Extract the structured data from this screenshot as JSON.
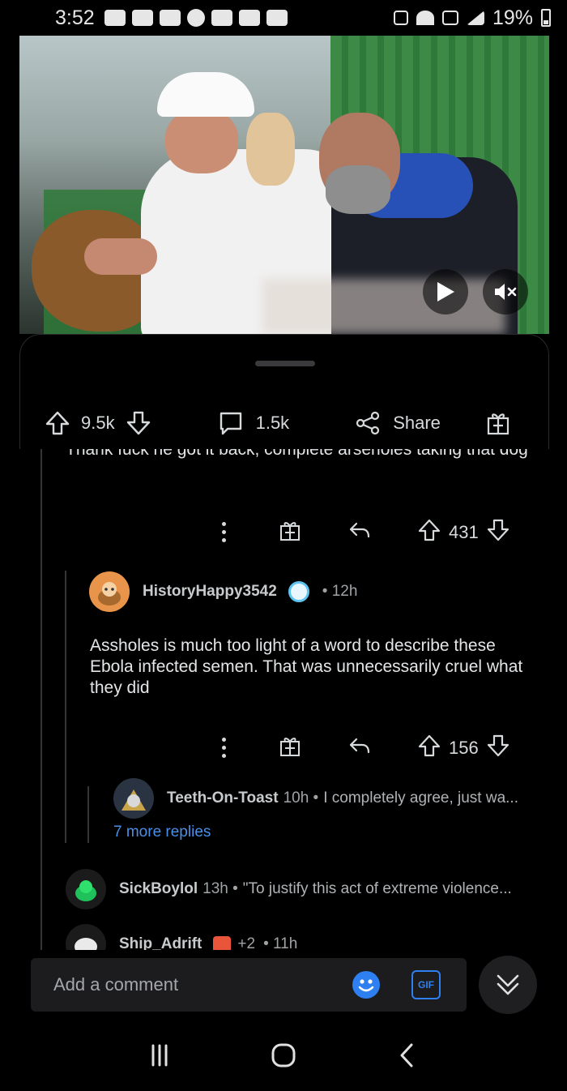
{
  "status_bar": {
    "time": "3:52",
    "battery": "19%"
  },
  "video": {
    "play_label": "play",
    "mute_label": "muted"
  },
  "post_actions": {
    "upvotes": "9.5k",
    "comments": "1.5k",
    "share": "Share"
  },
  "comments": [
    {
      "text": "Thank fuck he got it back, complete arseholes taking that dog",
      "votes": "431"
    },
    {
      "username": "HistoryHappy3542",
      "time": "• 12h",
      "text": "Assholes is much too light of a word to describe these Ebola infected semen. That was unnecessarily cruel what they did",
      "votes": "156"
    },
    {
      "username": "Teeth-On-Toast",
      "time": "10h •",
      "snippet": "I completely agree, just wa...",
      "more_replies": "7 more replies"
    },
    {
      "username": "SickBoylol",
      "time": "13h •",
      "snippet": "\"To justify this act of extreme violence..."
    },
    {
      "username": "Ship_Adrift",
      "awards": "+2",
      "time": "• 11h"
    }
  ],
  "comment_input": {
    "placeholder": "Add a comment",
    "gif_label": "GIF"
  },
  "colors": {
    "accent_blue": "#2e7ff0",
    "link_blue": "#4a8fe7",
    "background": "#000000"
  }
}
